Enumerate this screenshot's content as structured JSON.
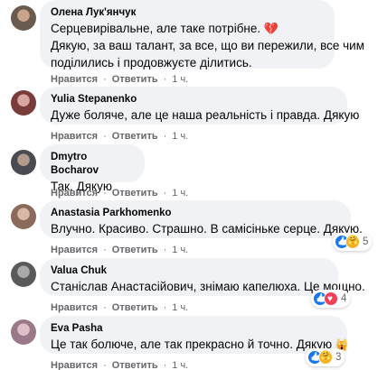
{
  "comments": [
    {
      "author": "Олена Лук'янчук",
      "lines": [
        "Серцевирівальне, але таке потрібне.",
        "Дякую, за ваш талант, за все, що ви пережили, все чим",
        "поділились і продовжуєте ділитись."
      ],
      "emoji": "💔",
      "like_label": "Нравится",
      "reply_label": "Ответить",
      "time": "1 ч.",
      "avatar_color": "#6b5a4e"
    },
    {
      "author": "Yulia Stepanenko",
      "lines": [
        "Дуже боляче, але це наша реальність і правда. Дякую"
      ],
      "like_label": "Нравится",
      "reply_label": "Ответить",
      "time": "1 ч.",
      "avatar_color": "#7a3b3b"
    },
    {
      "author": "Dmytro Bocharov",
      "lines": [
        "Так. Дякую"
      ],
      "like_label": "Нравится",
      "reply_label": "Ответить",
      "time": "1 ч.",
      "avatar_color": "#4a4a52"
    },
    {
      "author": "Anastasia Parkhomenko",
      "lines": [
        "Влучно. Красиво. Страшно. В самісіньке серце. Дякую."
      ],
      "like_label": "Нравится",
      "reply_label": "Ответить",
      "time": "1 ч.",
      "reaction_count": "5",
      "avatar_color": "#8a6a5a"
    },
    {
      "author": "Valua Chuk",
      "lines": [
        "Станіслав Анастасійович, знімаю капелюха. Це мощно."
      ],
      "like_label": "Нравится",
      "reply_label": "Ответить",
      "time": "1 ч.",
      "reaction_count": "4",
      "avatar_color": "#5a5a5a"
    },
    {
      "author": "Eva Pasha",
      "lines": [
        "Це так болюче, але так прекрасно й точно. Дякую"
      ],
      "like_label": "Нравится",
      "reply_label": "Ответить",
      "time": "1 ч.",
      "reaction_count": "3",
      "avatar_color": "#9a7a8a"
    }
  ],
  "separator": "·"
}
